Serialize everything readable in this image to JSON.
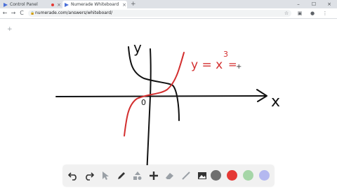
{
  "browser": {
    "tabs": [
      {
        "label": "Control Panel",
        "close": "×"
      },
      {
        "label": "Numerade Whiteboard",
        "close": "×"
      }
    ],
    "new_tab": "+",
    "window_controls": [
      "–",
      "☐",
      "×"
    ],
    "url": "numerade.com/answers/whiteboard/",
    "nav": {
      "back": "←",
      "forward": "→",
      "reload": "C"
    },
    "star": "☆",
    "menu": "⋮"
  },
  "whiteboard": {
    "add_page": "+",
    "drawing": {
      "y_axis_label": "y",
      "x_axis_label": "x",
      "origin_label": "0",
      "equation": "y = x",
      "exponent": "3",
      "trailing": "=",
      "red_curve_color": "#d32f2f",
      "ink_color": "#111111"
    }
  },
  "toolbar": {
    "tools": [
      "undo-icon",
      "redo-icon",
      "select-icon",
      "pen-icon",
      "shapes-icon",
      "add-icon",
      "eraser-icon",
      "line-icon",
      "image-icon"
    ],
    "colors": [
      {
        "name": "gray",
        "hex": "#6f6f6f"
      },
      {
        "name": "red",
        "hex": "#e53935"
      },
      {
        "name": "green",
        "hex": "#a5d6a7"
      },
      {
        "name": "lavender",
        "hex": "#b4b8f0"
      }
    ]
  }
}
